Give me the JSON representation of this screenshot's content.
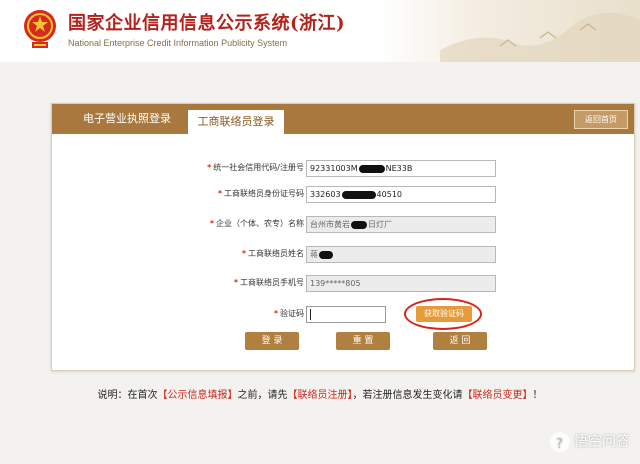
{
  "header": {
    "title_cn": "国家企业信用信息公示系统(浙江)",
    "title_en": "National Enterprise Credit Information Publicity System"
  },
  "tabs": {
    "license_login": "电子营业执照登录",
    "liaison_login": "工商联络员登录",
    "back_home": "返回首页"
  },
  "form": {
    "credit_code": {
      "label": "统一社会信用代码/注册号",
      "value_start": "92331003M",
      "value_end": "NE33B"
    },
    "id_number": {
      "label": "工商联络员身份证号码",
      "value_start": "332603",
      "value_end": "40510"
    },
    "enterprise_name": {
      "label": "企业（个体、农专）名称",
      "value_start": "台州市黄岩",
      "value_end": "日灯厂"
    },
    "liaison_name": {
      "label": "工商联络员姓名",
      "value_start": "蒋"
    },
    "liaison_phone": {
      "label": "工商联络员手机号",
      "value": "139*****805"
    },
    "captcha": {
      "label": "验证码",
      "get_code": "获取验证码"
    }
  },
  "buttons": {
    "login": "登 录",
    "reset": "重 置",
    "back": "返 回"
  },
  "notice": {
    "prefix": "说明：在首次",
    "link1": "【公示信息填报】",
    "middle1": "之前，请先",
    "link2": "【联络员注册】",
    "middle2": "，若注册信息发生变化请",
    "link3": "【联络员变更】",
    "suffix": "！"
  },
  "watermark": "悟空问答",
  "colors": {
    "brand_red": "#b3231b",
    "tab_bar": "#a8783f",
    "button": "#b08040",
    "get_code": "#e79a3a",
    "required": "#e02a1f"
  }
}
